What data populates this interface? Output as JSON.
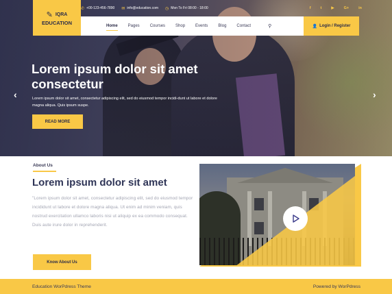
{
  "topbar": {
    "phone": "+00-123-456-7890",
    "email": "info@education.com",
    "hours": "Mon To Fri 08:00 - 18:00",
    "socials": [
      "f",
      "t",
      "▶",
      "G+",
      "in"
    ]
  },
  "logo": {
    "line1": "IQRA",
    "line2": "EDUCATION"
  },
  "nav": {
    "items": [
      "Home",
      "Pages",
      "Courses",
      "Shop",
      "Events",
      "Blog",
      "Contact"
    ],
    "login_label": "Login / Register"
  },
  "hero": {
    "headline": "Lorem ipsum dolor sit amet consectetur",
    "text": "Lorem ipsum dolor sit amet, consectetur adipiscing elit, sed do eiusmod tempor incidi-dunt ut labore et dolore magna aliqua. Quis ipsum suspe.",
    "button": "READ MORE"
  },
  "about": {
    "label": "About Us",
    "title": "Lorem ipsum dolor sit amet",
    "text": "\"Lorem ipsum dolor sit amet, consectetur adipiscing elit, sed do eiusmod tempor incididunt ut labore et dolore magna aliqua. Ut enim ad minim veniam, quis nostrud exercitation ullamco laboris nisi ut aliquip ex ea commodo consequat. Duis aute irure dolor in reprehenderit.",
    "button": "Know About Us"
  },
  "footer": {
    "left": "Education WorPdress Theme",
    "right": "Powered by WorPdress"
  },
  "colors": {
    "accent": "#f9c846",
    "navy": "#2f3557"
  }
}
